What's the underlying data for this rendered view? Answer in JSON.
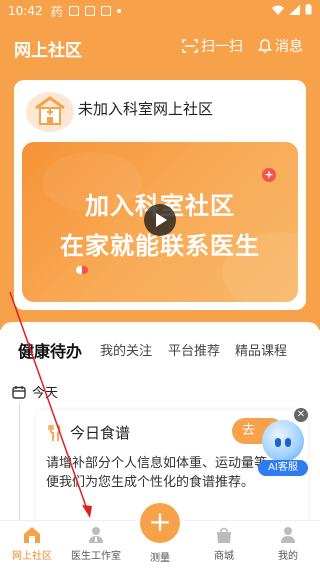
{
  "status_bar": {
    "time": "10:42",
    "app_glyph": "药"
  },
  "header": {
    "title": "网上社区",
    "scan_label": "扫一扫",
    "message_label": "消息"
  },
  "community_card": {
    "title": "未加入科室网上社区",
    "banner_line1": "加入科室社区",
    "banner_line2": "在家就能联系医生"
  },
  "tabs": [
    "健康待办",
    "我的关注",
    "平台推荐",
    "精品课程"
  ],
  "timeline": {
    "today_label": "今天"
  },
  "task": {
    "title": "今日食谱",
    "go_label": "去",
    "description": "请增补部分个人信息如体重、运动量等，以便我们为您生成个性化的食谱推荐。"
  },
  "ai_service": {
    "label": "AI客服"
  },
  "bottom_nav": {
    "items": [
      "网上社区",
      "医生工作室",
      "测量",
      "商城",
      "我的"
    ],
    "center_symbol": "+"
  },
  "colors": {
    "accent": "#f7a24a",
    "active_nav": "#f28b2e",
    "ai_blue": "#2f7bf2"
  }
}
